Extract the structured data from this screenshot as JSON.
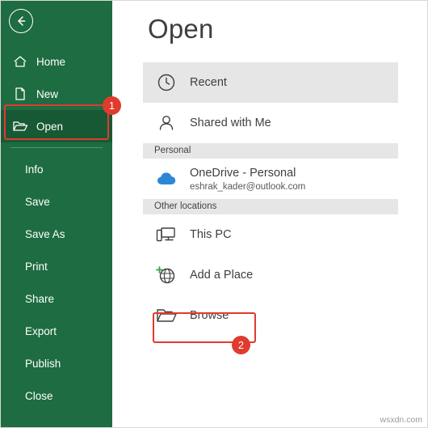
{
  "window": {
    "back_icon": "back-arrow-icon",
    "watermark": "wsxdn.com"
  },
  "sidebar": {
    "items": [
      {
        "label": "Home",
        "icon": "home-icon",
        "selected": false
      },
      {
        "label": "New",
        "icon": "new-document-icon",
        "selected": false
      },
      {
        "label": "Open",
        "icon": "open-folder-icon",
        "selected": true
      },
      {
        "label": "Info",
        "icon": "",
        "selected": false
      },
      {
        "label": "Save",
        "icon": "",
        "selected": false
      },
      {
        "label": "Save As",
        "icon": "",
        "selected": false
      },
      {
        "label": "Print",
        "icon": "",
        "selected": false
      },
      {
        "label": "Share",
        "icon": "",
        "selected": false
      },
      {
        "label": "Export",
        "icon": "",
        "selected": false
      },
      {
        "label": "Publish",
        "icon": "",
        "selected": false
      },
      {
        "label": "Close",
        "icon": "",
        "selected": false
      }
    ]
  },
  "main": {
    "title": "Open",
    "entries": [
      {
        "type": "item",
        "label": "Recent",
        "sub": "",
        "icon": "clock-icon",
        "selected": true
      },
      {
        "type": "item",
        "label": "Shared with Me",
        "sub": "",
        "icon": "person-icon",
        "selected": false
      },
      {
        "type": "group",
        "label": "Personal"
      },
      {
        "type": "item",
        "label": "OneDrive - Personal",
        "sub": "eshrak_kader@outlook.com",
        "icon": "onedrive-cloud-icon",
        "selected": false
      },
      {
        "type": "group",
        "label": "Other locations"
      },
      {
        "type": "item",
        "label": "This PC",
        "sub": "",
        "icon": "this-pc-icon",
        "selected": false
      },
      {
        "type": "item",
        "label": "Add a Place",
        "sub": "",
        "icon": "add-a-place-icon",
        "selected": false
      },
      {
        "type": "item",
        "label": "Browse",
        "sub": "",
        "icon": "browse-folder-icon",
        "selected": false
      }
    ]
  },
  "annotations": {
    "badge1": "1",
    "badge2": "2",
    "accent_color": "#e03b2f",
    "brand_color": "#1e6c41"
  }
}
